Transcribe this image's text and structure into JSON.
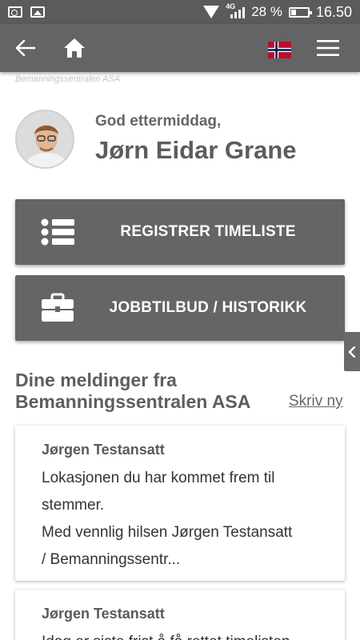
{
  "status_bar": {
    "network_label": "4G",
    "battery_percent": "28 %",
    "time": "16.50"
  },
  "app_bar": {
    "back_icon": "arrow-left-icon",
    "home_icon": "home-icon",
    "flag_icon": "norway-flag-icon",
    "menu_icon": "hamburger-menu-icon"
  },
  "brand_caption": "Bemanningssentralen ASA",
  "greeting": {
    "salutation": "God ettermiddag,",
    "user_name": "Jørn Eidar Grane"
  },
  "actions": {
    "register_timesheet": "REGISTRER TIMELISTE",
    "job_offers": "JOBBTILBUD / HISTORIKK"
  },
  "messages": {
    "heading_line1": "Dine meldinger fra",
    "heading_line2": "Bemanningssentralen ASA",
    "write_new": "Skriv ny",
    "items": [
      {
        "sender": "Jørgen Testansatt",
        "line1": "Lokasjonen du har kommet frem til",
        "line2": "stemmer.",
        "line3": "Med vennlig hilsen Jørgen Testansatt",
        "line4": "/ Bemanningssentr..."
      },
      {
        "sender": "Jørgen Testansatt",
        "line1": "Idag er siste frist å få rettet timelisten"
      }
    ]
  },
  "colors": {
    "status_bar": "#5b5b5b",
    "app_bar": "#646464",
    "button": "#656565",
    "text_dark": "#5c5c5c"
  }
}
